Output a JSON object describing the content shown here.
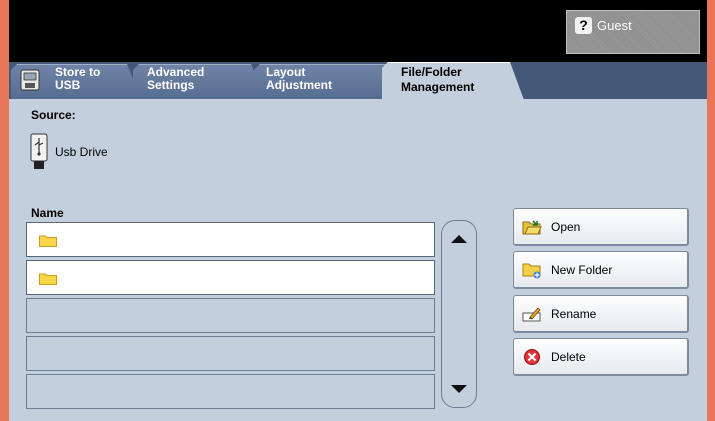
{
  "header": {
    "guest_label": "Guest",
    "guest_icon": "help-question-icon"
  },
  "tabs": [
    {
      "line1": "Store to",
      "line2": "USB"
    },
    {
      "line1": "Advanced",
      "line2": "Settings"
    },
    {
      "line1": "Layout",
      "line2": "Adjustment"
    },
    {
      "line1": "File/Folder",
      "line2": "Management",
      "active": true
    }
  ],
  "source": {
    "label": "Source:",
    "device": "Usb Drive"
  },
  "file_list": {
    "column_header": "Name",
    "rows": [
      {
        "type": "folder",
        "name": ""
      },
      {
        "type": "folder",
        "name": ""
      },
      {
        "type": "empty",
        "name": ""
      },
      {
        "type": "empty",
        "name": ""
      },
      {
        "type": "empty",
        "name": ""
      }
    ]
  },
  "actions": {
    "open": "Open",
    "new_folder": "New Folder",
    "rename": "Rename",
    "delete": "Delete"
  },
  "colors": {
    "frame": "#e8775a",
    "tab_bar": "#44597a",
    "panel": "#c3cfdc",
    "top_bar": "#000000"
  }
}
